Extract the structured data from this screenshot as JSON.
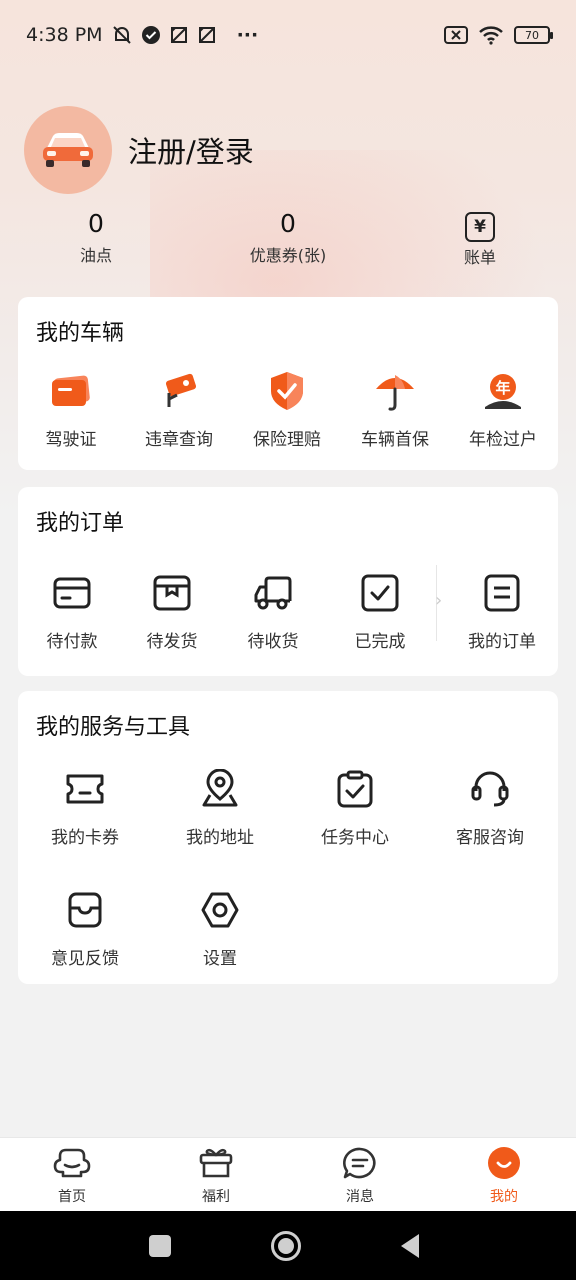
{
  "status_bar": {
    "time": "4:38 PM",
    "dots": "···",
    "battery": "70"
  },
  "profile": {
    "login_label": "注册/登录"
  },
  "stats": [
    {
      "value": "0",
      "label": "油点"
    },
    {
      "value": "0",
      "label": "优惠券(张)"
    },
    {
      "value": "¥",
      "label": "账单"
    }
  ],
  "vehicles": {
    "title": "我的车辆",
    "items": [
      {
        "label": "驾驶证",
        "icon": "license-card-icon"
      },
      {
        "label": "违章查询",
        "icon": "traffic-camera-icon"
      },
      {
        "label": "保险理赔",
        "icon": "shield-check-icon"
      },
      {
        "label": "车辆首保",
        "icon": "umbrella-icon"
      },
      {
        "label": "年检过户",
        "icon": "annual-inspection-icon"
      }
    ],
    "annual_glyph": "年"
  },
  "orders": {
    "title": "我的订单",
    "items": [
      {
        "label": "待付款",
        "icon": "wallet-icon"
      },
      {
        "label": "待发货",
        "icon": "box-icon"
      },
      {
        "label": "待收货",
        "icon": "truck-icon"
      },
      {
        "label": "已完成",
        "icon": "checkbox-icon"
      },
      {
        "label": "我的订单",
        "icon": "order-list-icon"
      }
    ]
  },
  "services": {
    "title": "我的服务与工具",
    "items": [
      {
        "label": "我的卡券",
        "icon": "ticket-icon"
      },
      {
        "label": "我的地址",
        "icon": "location-pin-icon"
      },
      {
        "label": "任务中心",
        "icon": "clipboard-check-icon"
      },
      {
        "label": "客服咨询",
        "icon": "headset-icon"
      },
      {
        "label": "意见反馈",
        "icon": "feedback-icon"
      },
      {
        "label": "设置",
        "icon": "settings-hex-icon"
      }
    ]
  },
  "bottom_nav": [
    {
      "label": "首页",
      "icon": "home-icon"
    },
    {
      "label": "福利",
      "icon": "gift-icon"
    },
    {
      "label": "消息",
      "icon": "message-icon"
    },
    {
      "label": "我的",
      "icon": "profile-icon",
      "active": true
    }
  ],
  "colors": {
    "accent": "#f05a1a",
    "accent_light": "#f8845a",
    "avatar_bg": "#f3b9a2"
  }
}
